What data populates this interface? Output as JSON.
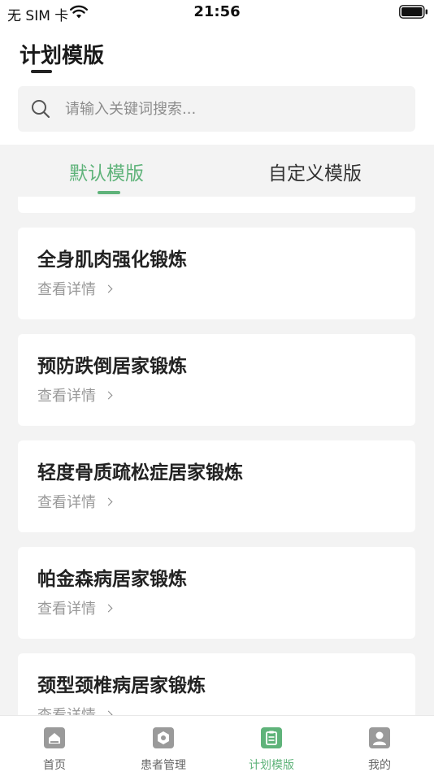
{
  "status_bar": {
    "carrier": "无 SIM 卡",
    "time": "21:56"
  },
  "header": {
    "title": "计划模版"
  },
  "search": {
    "placeholder": "请输入关键词搜索..."
  },
  "tabs": [
    {
      "label": "默认模版",
      "active": true
    },
    {
      "label": "自定义模版",
      "active": false
    }
  ],
  "templates": [
    {
      "title": "全身肌肉强化锻炼",
      "link": "查看详情"
    },
    {
      "title": "预防跌倒居家锻炼",
      "link": "查看详情"
    },
    {
      "title": "轻度骨质疏松症居家锻炼",
      "link": "查看详情"
    },
    {
      "title": "帕金森病居家锻炼",
      "link": "查看详情"
    },
    {
      "title": "颈型颈椎病居家锻炼",
      "link": "查看详情"
    }
  ],
  "tab_bar": [
    {
      "label": "首页",
      "icon": "home-icon",
      "active": false
    },
    {
      "label": "患者管理",
      "icon": "patient-management-icon",
      "active": false
    },
    {
      "label": "计划模版",
      "icon": "clipboard-icon",
      "active": true
    },
    {
      "label": "我的",
      "icon": "user-icon",
      "active": false
    }
  ],
  "colors": {
    "accent": "#5fb37a",
    "background": "#f3f3f3",
    "card": "#ffffff"
  }
}
